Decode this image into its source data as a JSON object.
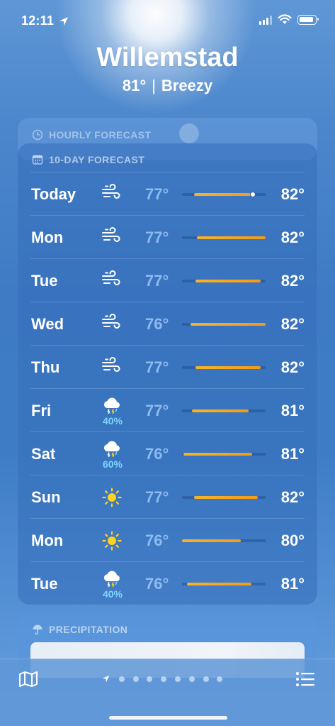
{
  "status_bar": {
    "time": "12:11"
  },
  "header": {
    "city": "Willemstad",
    "temp": "81°",
    "condition": "Breezy",
    "separator": "|"
  },
  "hourly_card": {
    "title": "HOURLY FORECAST"
  },
  "tenday_card": {
    "title": "10-DAY FORECAST",
    "days": [
      {
        "day": "Today",
        "icon": "wind-icon",
        "precip": "",
        "low": "77°",
        "high": "82°",
        "bar_start": 0.14,
        "bar_end": 0.86,
        "now_marker": 0.85
      },
      {
        "day": "Mon",
        "icon": "wind-icon",
        "precip": "",
        "low": "77°",
        "high": "82°",
        "bar_start": 0.18,
        "bar_end": 1.0
      },
      {
        "day": "Tue",
        "icon": "wind-icon",
        "precip": "",
        "low": "77°",
        "high": "82°",
        "bar_start": 0.16,
        "bar_end": 0.94
      },
      {
        "day": "Wed",
        "icon": "wind-icon",
        "precip": "",
        "low": "76°",
        "high": "82°",
        "bar_start": 0.1,
        "bar_end": 1.0
      },
      {
        "day": "Thu",
        "icon": "wind-icon",
        "precip": "",
        "low": "77°",
        "high": "82°",
        "bar_start": 0.16,
        "bar_end": 0.94
      },
      {
        "day": "Fri",
        "icon": "thunderstorm-icon",
        "precip": "40%",
        "low": "77°",
        "high": "81°",
        "bar_start": 0.12,
        "bar_end": 0.8
      },
      {
        "day": "Sat",
        "icon": "thunderstorm-icon",
        "precip": "60%",
        "low": "76°",
        "high": "81°",
        "bar_start": 0.02,
        "bar_end": 0.84
      },
      {
        "day": "Sun",
        "icon": "sun-icon",
        "precip": "",
        "low": "77°",
        "high": "82°",
        "bar_start": 0.14,
        "bar_end": 0.91
      },
      {
        "day": "Mon",
        "icon": "sun-icon",
        "precip": "",
        "low": "76°",
        "high": "80°",
        "bar_start": 0.0,
        "bar_end": 0.7
      },
      {
        "day": "Tue",
        "icon": "thunderstorm-icon",
        "precip": "40%",
        "low": "76°",
        "high": "81°",
        "bar_start": 0.06,
        "bar_end": 0.83
      }
    ]
  },
  "precip_card": {
    "title": "PRECIPITATION"
  },
  "bottom_bar": {
    "page_dots": 8,
    "active_item": "location-arrow-icon"
  },
  "colors": {
    "bar_orange": "#f29a1a",
    "precip_blue": "#7fd3ff",
    "card_bg": "#346eba"
  }
}
